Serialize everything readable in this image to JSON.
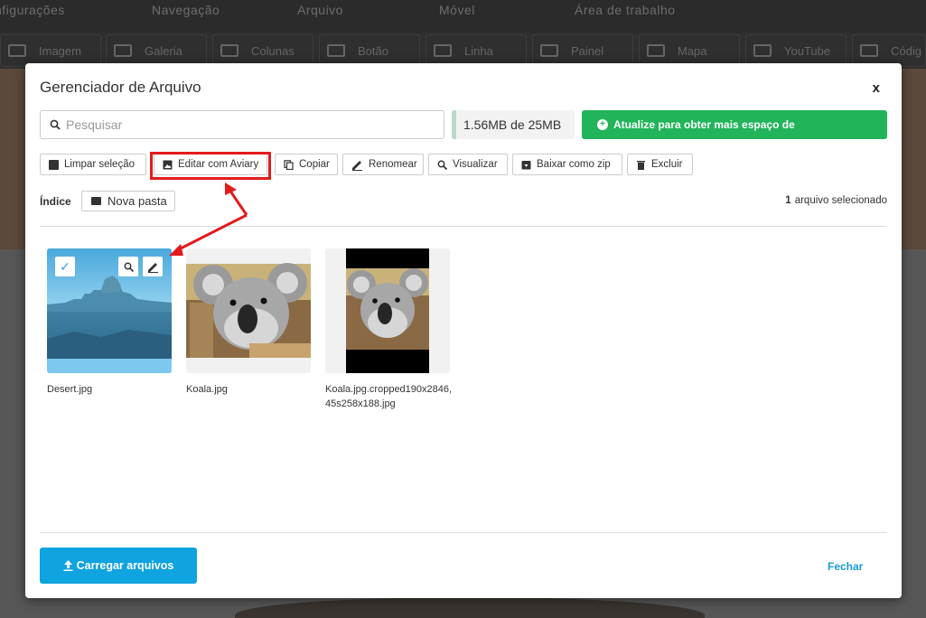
{
  "background": {
    "nav": [
      "nfigurações",
      "Navegação",
      "Arquivo",
      "Móvel",
      "Área de trabalho"
    ],
    "toolbar": [
      "Imagem",
      "Galeria",
      "Colunas",
      "Botão",
      "Linha",
      "Painel",
      "Mapa",
      "YouTube",
      "Códig"
    ]
  },
  "modal": {
    "title": "Gerenciador de Arquivo",
    "close": "x",
    "search_placeholder": "Pesquisar",
    "usage": "1.56MB de 25MB",
    "upgrade": "Atualize para obter mais espaço de",
    "actions": {
      "clear": "Limpar seleção",
      "aviary": "Editar com Aviary",
      "copy": "Copiar",
      "rename": "Renomear",
      "view": "Visualizar",
      "zip": "Baixar como zip",
      "delete": "Excluir"
    },
    "breadcrumb": "Índice",
    "new_folder": "Nova pasta",
    "selected_count": "1",
    "selected_text": "arquivo selecionado",
    "files": [
      {
        "name": "Desert.jpg",
        "selected": true
      },
      {
        "name": "Koala.jpg",
        "selected": false
      },
      {
        "name": "Koala.jpg.cropped190x2846,45s258x188.jpg",
        "selected": false
      }
    ],
    "upload": "Carregar arquivos",
    "close_link": "Fechar"
  },
  "colors": {
    "accent": "#0fa3e0",
    "upgrade": "#22b45a",
    "highlight": "#e21b1b"
  }
}
